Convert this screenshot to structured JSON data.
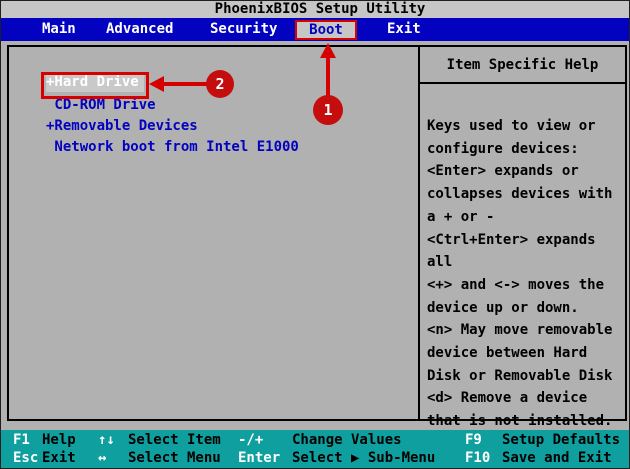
{
  "title_bar": {
    "title": "PhoenixBIOS Setup Utility"
  },
  "menu_bar": {
    "selected": "Boot",
    "items": [
      {
        "label": "Main"
      },
      {
        "label": "Advanced"
      },
      {
        "label": "Security"
      },
      {
        "label": "Boot"
      },
      {
        "label": "Exit"
      }
    ]
  },
  "boot_menu": {
    "items": [
      {
        "label": "+Hard Drive",
        "selected": true
      },
      {
        "label": " CD-ROM Drive",
        "selected": false
      },
      {
        "label": "+Removable Devices",
        "selected": false
      },
      {
        "label": " Network boot from Intel E1000",
        "selected": false
      }
    ]
  },
  "help_panel": {
    "title": "Item Specific Help",
    "lines": [
      "Keys used to view or",
      "configure devices:",
      "<Enter> expands or",
      "collapses devices with",
      "a + or -",
      "<Ctrl+Enter> expands",
      "all",
      "<+> and <-> moves the",
      "device up or down.",
      "<n> May move removable",
      "device between Hard",
      "Disk or Removable Disk",
      "<d> Remove a device",
      "that is not installed."
    ]
  },
  "status_bar": {
    "row1": [
      {
        "key": "F1",
        "label": "Help"
      },
      {
        "key": "↑↓",
        "label": "Select Item"
      },
      {
        "key": "-/+",
        "label": "Change Values"
      },
      {
        "key": "F9",
        "label": "Setup Defaults"
      }
    ],
    "row2": [
      {
        "key": "Esc",
        "label": "Exit"
      },
      {
        "key": "↔",
        "label": "Select Menu"
      },
      {
        "key": "Enter",
        "label": "Select ▶ Sub-Menu"
      },
      {
        "key": "F10",
        "label": "Save and Exit"
      }
    ]
  },
  "annotations": {
    "step_1": "1",
    "step_2": "2"
  },
  "colors": {
    "menu_blue": "#0202c0",
    "status_teal": "#109f9f",
    "annotation_red": "#d60000",
    "background_gray": "#b1b1b1",
    "title_gray": "#c6c6c6",
    "highlight_gray": "#c9c9c9"
  }
}
